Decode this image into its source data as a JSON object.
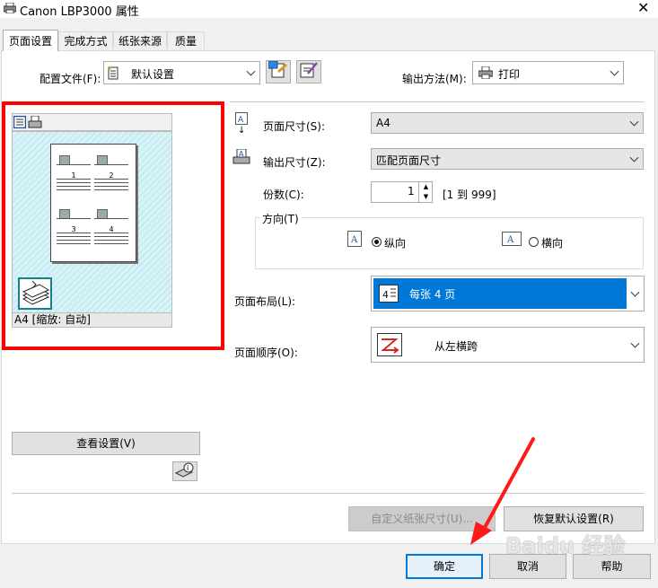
{
  "window": {
    "title": "Canon LBP3000 属性",
    "close_glyph": "✕"
  },
  "tabs": [
    {
      "label": "页面设置",
      "active": true
    },
    {
      "label": "完成方式"
    },
    {
      "label": "纸张来源"
    },
    {
      "label": "质量"
    }
  ],
  "profile": {
    "label": "配置文件(F):",
    "value": "默认设置"
  },
  "output_method": {
    "label": "输出方法(M):",
    "value": "打印"
  },
  "preview": {
    "page_numbers": [
      "1",
      "2",
      "3",
      "4"
    ],
    "caption": "A4 [缩放: 自动]"
  },
  "page_size": {
    "label": "页面尺寸(S):",
    "value": "A4"
  },
  "output_size": {
    "label": "输出尺寸(Z):",
    "value": "匹配页面尺寸"
  },
  "copies": {
    "label": "份数(C):",
    "value": "1",
    "range": "[1 到 999]"
  },
  "orientation": {
    "group": "方向(T)",
    "portrait": "纵向",
    "landscape": "横向",
    "selected": "portrait"
  },
  "layout": {
    "label": "页面布局(L):",
    "value": "每张 4 页"
  },
  "order": {
    "label": "页面顺序(O):",
    "value": "从左横跨"
  },
  "buttons": {
    "view_settings": "查看设置(V)",
    "custom_paper": "自定义纸张尺寸(U)...",
    "restore_defaults": "恢复默认设置(R)",
    "ok": "确定",
    "cancel": "取消",
    "help": "帮助"
  },
  "watermark": "Baidu 经验",
  "colors": {
    "highlight": "#0078d7",
    "annotation": "#ff0000"
  }
}
